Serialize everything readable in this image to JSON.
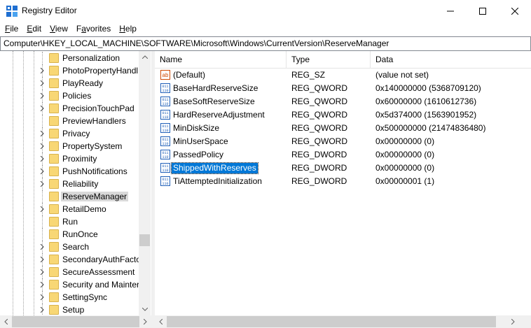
{
  "window": {
    "title": "Registry Editor"
  },
  "menu": [
    {
      "mnemonic": "F",
      "rest": "ile"
    },
    {
      "mnemonic": "E",
      "rest": "dit"
    },
    {
      "mnemonic": "V",
      "rest": "iew"
    },
    {
      "mnemonic": "",
      "pre": "F",
      "mnemonic2": "a",
      "rest": "vorites"
    },
    {
      "mnemonic": "H",
      "rest": "elp"
    }
  ],
  "menu_labels": {
    "file_m": "F",
    "file_r": "ile",
    "edit_m": "E",
    "edit_r": "dit",
    "view_m": "V",
    "view_r": "iew",
    "fav_p": "F",
    "fav_m": "a",
    "fav_r": "vorites",
    "help_m": "H",
    "help_r": "elp"
  },
  "address": "Computer\\HKEY_LOCAL_MACHINE\\SOFTWARE\\Microsoft\\Windows\\CurrentVersion\\ReserveManager",
  "tree": {
    "items": [
      {
        "label": "Personalization",
        "expandable": false
      },
      {
        "label": "PhotoPropertyHandl",
        "expandable": true
      },
      {
        "label": "PlayReady",
        "expandable": true
      },
      {
        "label": "Policies",
        "expandable": true
      },
      {
        "label": "PrecisionTouchPad",
        "expandable": true
      },
      {
        "label": "PreviewHandlers",
        "expandable": false
      },
      {
        "label": "Privacy",
        "expandable": true
      },
      {
        "label": "PropertySystem",
        "expandable": true
      },
      {
        "label": "Proximity",
        "expandable": true
      },
      {
        "label": "PushNotifications",
        "expandable": true
      },
      {
        "label": "Reliability",
        "expandable": true
      },
      {
        "label": "ReserveManager",
        "expandable": false,
        "selected": true
      },
      {
        "label": "RetailDemo",
        "expandable": true
      },
      {
        "label": "Run",
        "expandable": false
      },
      {
        "label": "RunOnce",
        "expandable": false
      },
      {
        "label": "Search",
        "expandable": true
      },
      {
        "label": "SecondaryAuthFacto",
        "expandable": true
      },
      {
        "label": "SecureAssessment",
        "expandable": true
      },
      {
        "label": "Security and Mainter",
        "expandable": true
      },
      {
        "label": "SettingSync",
        "expandable": true
      },
      {
        "label": "Setup",
        "expandable": true
      }
    ]
  },
  "columns": {
    "name": "Name",
    "type": "Type",
    "data": "Data"
  },
  "values": [
    {
      "icon": "string-value-icon",
      "name": "(Default)",
      "type": "REG_SZ",
      "data": "(value not set)"
    },
    {
      "icon": "binary-value-icon",
      "name": "BaseHardReserveSize",
      "type": "REG_QWORD",
      "data": "0x140000000 (5368709120)"
    },
    {
      "icon": "binary-value-icon",
      "name": "BaseSoftReserveSize",
      "type": "REG_QWORD",
      "data": "0x60000000 (1610612736)"
    },
    {
      "icon": "binary-value-icon",
      "name": "HardReserveAdjustment",
      "type": "REG_QWORD",
      "data": "0x5d374000 (1563901952)"
    },
    {
      "icon": "binary-value-icon",
      "name": "MinDiskSize",
      "type": "REG_QWORD",
      "data": "0x500000000 (21474836480)"
    },
    {
      "icon": "binary-value-icon",
      "name": "MinUserSpace",
      "type": "REG_QWORD",
      "data": "0x00000000 (0)"
    },
    {
      "icon": "binary-value-icon",
      "name": "PassedPolicy",
      "type": "REG_DWORD",
      "data": "0x00000000 (0)"
    },
    {
      "icon": "binary-value-icon",
      "name": "ShippedWithReserves",
      "type": "REG_DWORD",
      "data": "0x00000000 (0)",
      "selected": true
    },
    {
      "icon": "binary-value-icon",
      "name": "TiAttemptedInitialization",
      "type": "REG_DWORD",
      "data": "0x00000001 (1)"
    }
  ],
  "colors": {
    "selection": "#0078d7",
    "tree_selection": "#d9d9d9",
    "folder": "#f8d775"
  }
}
